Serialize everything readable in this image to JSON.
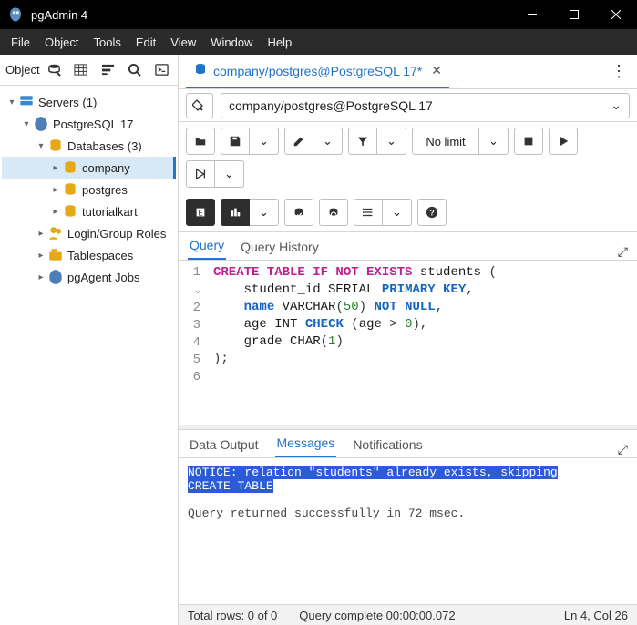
{
  "window": {
    "title": "pgAdmin 4"
  },
  "menu": [
    "File",
    "Object",
    "Tools",
    "Edit",
    "View",
    "Window",
    "Help"
  ],
  "sidebar": {
    "title": "Object",
    "tree": {
      "servers": "Servers (1)",
      "pg": "PostgreSQL 17",
      "databases": "Databases (3)",
      "db_company": "company",
      "db_postgres": "postgres",
      "db_tutorialkart": "tutorialkart",
      "login_roles": "Login/Group Roles",
      "tablespaces": "Tablespaces",
      "pgagent": "pgAgent Jobs"
    }
  },
  "tab": {
    "label": "company/postgres@PostgreSQL 17*"
  },
  "connection": {
    "value": "company/postgres@PostgreSQL 17"
  },
  "toolbar": {
    "limit": "No limit"
  },
  "query_tabs": {
    "query": "Query",
    "history": "Query History"
  },
  "sql": {
    "lines": [
      "1",
      "2",
      "3",
      "4",
      "5",
      "6"
    ]
  },
  "result_tabs": {
    "data": "Data Output",
    "messages": "Messages",
    "notif": "Notifications"
  },
  "messages": {
    "notice": "NOTICE:  relation \"students\" already exists, skipping",
    "create": "CREATE TABLE",
    "returned": "Query returned successfully in 72 msec."
  },
  "status": {
    "rows": "Total rows: 0 of 0",
    "complete": "Query complete 00:00:00.072",
    "pos": "Ln 4, Col 26"
  }
}
